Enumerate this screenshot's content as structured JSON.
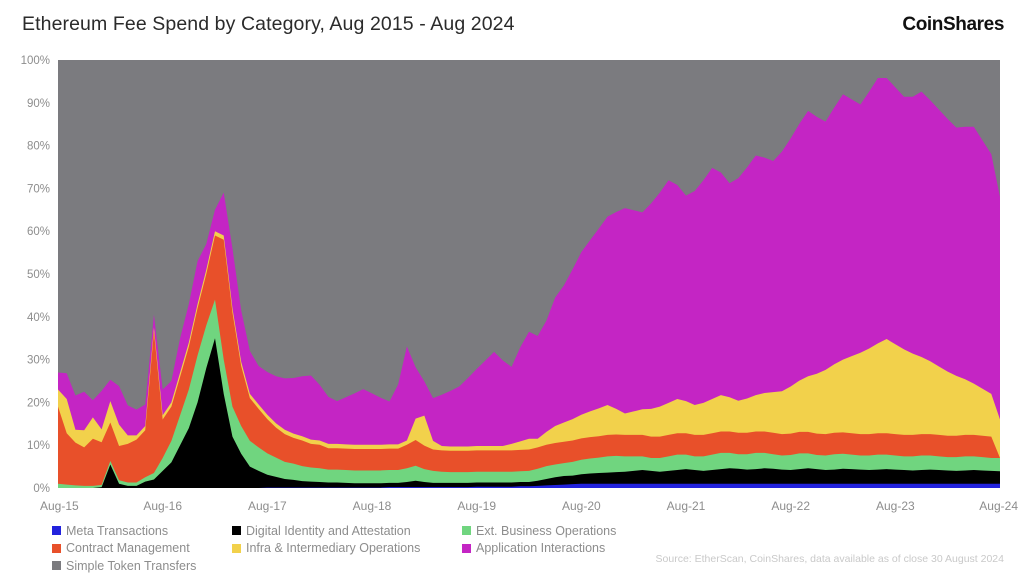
{
  "header": {
    "title": "Ethereum Fee Spend by Category, Aug 2015 - Aug 2024",
    "brand": "CoinShares"
  },
  "footer": {
    "source": "Source: EtherScan, CoinShares, data available as of close 30 August 2024"
  },
  "legend": {
    "rows": [
      [
        {
          "label": "Meta Transactions",
          "color": "#2222dd",
          "key": "meta_transactions"
        },
        {
          "label": "Digital Identity and Attestation",
          "color": "#000000",
          "key": "digital_identity"
        },
        {
          "label": "Ext. Business Operations",
          "color": "#70d57f",
          "key": "ext_business"
        }
      ],
      [
        {
          "label": "Contract Management",
          "color": "#e8502a",
          "key": "contract_management"
        },
        {
          "label": "Infra & Intermediary Operations",
          "color": "#f2d14b",
          "key": "infra_intermediary"
        },
        {
          "label": "Application Interactions",
          "color": "#c425c4",
          "key": "application_interactions"
        }
      ],
      [
        {
          "label": "Simple Token Transfers",
          "color": "#7b7b7f",
          "key": "simple_token_transfers"
        }
      ]
    ]
  },
  "chart_data": {
    "type": "area",
    "stacked": true,
    "normalized": true,
    "title": "Ethereum Fee Spend by Category, Aug 2015 - Aug 2024",
    "xlabel": "",
    "ylabel": "",
    "ylim": [
      0,
      100
    ],
    "yticks": [
      "0%",
      "10%",
      "20%",
      "30%",
      "40%",
      "50%",
      "60%",
      "70%",
      "80%",
      "90%",
      "100%"
    ],
    "ytick_values": [
      0,
      10,
      20,
      30,
      40,
      50,
      60,
      70,
      80,
      90,
      100
    ],
    "xticks": [
      "Aug-15",
      "Aug-16",
      "Aug-17",
      "Aug-18",
      "Aug-19",
      "Aug-20",
      "Aug-21",
      "Aug-22",
      "Aug-23",
      "Aug-24"
    ],
    "xtick_values": [
      0,
      12,
      24,
      36,
      48,
      60,
      72,
      84,
      96,
      108
    ],
    "x_unit": "months since Aug-2015",
    "x_count": 109,
    "grid": false,
    "legend_position": "bottom-left",
    "plot_background": "#7b7b7f",
    "series": [
      {
        "name": "Meta Transactions",
        "color": "#2222dd",
        "values": [
          0,
          0,
          0,
          0,
          0,
          0,
          0,
          0,
          0,
          0,
          0,
          0,
          0,
          0,
          0,
          0,
          0,
          0,
          0,
          0,
          0,
          0,
          0,
          0,
          0.1,
          0.1,
          0.1,
          0.1,
          0.1,
          0.1,
          0.1,
          0.1,
          0.1,
          0.1,
          0.1,
          0.1,
          0.1,
          0.1,
          0.2,
          0.2,
          0.2,
          0.2,
          0.2,
          0.2,
          0.2,
          0.2,
          0.2,
          0.2,
          0.3,
          0.3,
          0.3,
          0.3,
          0.3,
          0.4,
          0.4,
          0.5,
          0.6,
          0.7,
          0.8,
          0.9,
          1,
          1,
          1,
          1,
          1,
          1,
          1,
          1,
          1,
          1,
          1,
          1,
          1,
          1,
          1,
          1,
          1,
          1,
          1,
          1,
          1,
          1,
          1,
          1,
          1,
          1,
          1,
          1,
          1,
          1,
          1,
          1,
          1,
          1,
          1,
          1,
          1,
          1,
          1,
          1,
          1,
          1,
          1,
          1,
          1,
          1,
          1,
          1,
          1,
          1,
          1
        ]
      },
      {
        "name": "Digital Identity and Attestation",
        "color": "#000000",
        "values": [
          0,
          0,
          0,
          0,
          0,
          0.2,
          5.5,
          1,
          0.5,
          0.5,
          1.5,
          2,
          4,
          6,
          10,
          14,
          20,
          28,
          35,
          22,
          12,
          8,
          5,
          4,
          3,
          2.5,
          2,
          1.8,
          1.5,
          1.4,
          1.3,
          1.2,
          1.2,
          1.1,
          1,
          1,
          1,
          1,
          1,
          1,
          1.2,
          1.5,
          1.2,
          1,
          1,
          1,
          1,
          1,
          1,
          1,
          1,
          1,
          1,
          1,
          1,
          1.2,
          1.5,
          1.8,
          2,
          2,
          2.2,
          2.4,
          2.5,
          2.6,
          2.7,
          2.8,
          3,
          3.2,
          3,
          2.8,
          3,
          3.2,
          3.4,
          3.2,
          3,
          3.2,
          3.4,
          3.6,
          3.5,
          3.3,
          3.4,
          3.6,
          3.5,
          3.3,
          3.2,
          3.4,
          3.6,
          3.4,
          3.2,
          3.3,
          3.5,
          3.4,
          3.3,
          3.2,
          3.3,
          3.4,
          3.3,
          3.2,
          3.1,
          3.2,
          3.3,
          3.2,
          3.1,
          3,
          3.1,
          3.2,
          3.1,
          3,
          2.9,
          3
        ]
      },
      {
        "name": "Ext. Business Operations",
        "color": "#70d57f",
        "values": [
          1,
          0.8,
          0.6,
          0.5,
          0.5,
          0.5,
          0.8,
          0.8,
          0.8,
          0.8,
          1,
          1.5,
          3,
          5,
          7,
          9,
          11,
          10,
          9,
          8,
          7,
          6.5,
          6,
          5.5,
          5,
          4.5,
          4,
          3.8,
          3.5,
          3.3,
          3.2,
          3,
          3,
          3,
          3,
          3,
          3,
          3,
          3,
          3,
          3.2,
          3.5,
          3,
          2.8,
          2.6,
          2.5,
          2.5,
          2.5,
          2.5,
          2.5,
          2.5,
          2.5,
          2.5,
          2.5,
          2.6,
          2.8,
          3,
          3,
          3,
          3.2,
          3.4,
          3.5,
          3.6,
          3.8,
          3.8,
          3.6,
          3.4,
          3.2,
          3,
          3.2,
          3.4,
          3.6,
          3.4,
          3.2,
          3.4,
          3.6,
          3.8,
          3.6,
          3.4,
          3.6,
          3.8,
          3.6,
          3.4,
          3.3,
          3.5,
          3.7,
          3.5,
          3.3,
          3.4,
          3.6,
          3.5,
          3.4,
          3.3,
          3.4,
          3.5,
          3.4,
          3.3,
          3.2,
          3.3,
          3.4,
          3.3,
          3.2,
          3.1,
          3.2,
          3.3,
          3.2,
          3.1,
          3,
          3.1
        ]
      },
      {
        "name": "Contract Management",
        "color": "#e8502a",
        "values": [
          18,
          12,
          10,
          9,
          11,
          10,
          9,
          8,
          9,
          10,
          11,
          33,
          9,
          8,
          9,
          10,
          11,
          12,
          15,
          28,
          22,
          14,
          10,
          9,
          8,
          7,
          6.5,
          6,
          6,
          5.5,
          5.5,
          5,
          5,
          5,
          5,
          5,
          5,
          5,
          5,
          5,
          5.5,
          6,
          5.5,
          5,
          5,
          5,
          5,
          5,
          5,
          5,
          5,
          5,
          5,
          5,
          5,
          5,
          5,
          5,
          5,
          5,
          5,
          5,
          5,
          5,
          5,
          5,
          5,
          5,
          5,
          5,
          5,
          5,
          5,
          5,
          5,
          5,
          5,
          5,
          5,
          5,
          5,
          5,
          5,
          5,
          5,
          5,
          5,
          5,
          5,
          5,
          5,
          5,
          5,
          5,
          5,
          5,
          5,
          5,
          5,
          5,
          5,
          5,
          5,
          5,
          5,
          5,
          5,
          5
        ]
      },
      {
        "name": "Infra & Intermediary Operations",
        "color": "#f2d14b",
        "values": [
          4,
          8,
          3,
          4,
          5,
          3,
          5,
          5,
          2,
          1,
          1,
          1,
          1,
          1,
          1,
          1,
          1,
          1,
          1,
          1,
          1,
          1,
          1,
          1,
          1,
          1,
          1,
          1,
          1,
          1,
          1,
          1,
          1,
          1,
          1,
          1,
          1,
          1,
          1,
          1,
          1,
          5,
          7,
          2,
          1,
          1,
          1,
          1,
          1,
          1,
          1,
          1,
          1.5,
          2,
          2.5,
          2,
          3,
          4,
          4.5,
          5,
          5.5,
          6,
          6.5,
          7,
          6,
          5,
          5.5,
          6,
          6.5,
          7,
          7.5,
          8,
          7.5,
          7,
          7.5,
          8,
          8.5,
          8,
          7.5,
          8,
          8.5,
          9,
          9.5,
          10,
          11,
          12,
          13,
          14,
          15,
          16,
          17,
          18,
          19,
          20,
          21,
          22,
          21,
          20,
          19,
          18,
          17,
          16,
          15,
          14,
          13,
          12,
          11,
          10,
          9
        ]
      },
      {
        "name": "Application Interactions",
        "color": "#c425c4",
        "values": [
          4,
          6,
          8,
          9,
          4,
          9,
          5,
          9,
          7,
          6,
          5,
          3,
          6,
          5,
          8,
          9,
          10,
          6,
          5,
          10,
          14,
          12,
          10,
          9,
          10,
          11,
          12,
          13,
          14,
          15,
          13,
          11,
          10,
          11,
          12,
          13,
          12,
          11,
          10,
          14,
          22,
          12,
          8,
          10,
          12,
          13,
          14,
          16,
          18,
          20,
          22,
          20,
          18,
          22,
          25,
          24,
          26,
          30,
          32,
          35,
          38,
          40,
          42,
          44,
          46,
          48,
          47,
          46,
          48,
          50,
          52,
          50,
          48,
          50,
          52,
          54,
          52,
          50,
          52,
          54,
          56,
          55,
          54,
          56,
          58,
          60,
          62,
          60,
          58,
          60,
          62,
          60,
          58,
          60,
          62,
          61,
          60,
          59,
          60,
          62,
          61,
          60,
          59,
          58,
          59,
          60,
          58,
          56,
          52
        ]
      },
      {
        "name": "Simple Token Transfers",
        "color": "#7b7b7f",
        "values": [
          73,
          73.2,
          78.4,
          77.5,
          79.5,
          77.3,
          74.7,
          76.2,
          80.7,
          81.7,
          80.5,
          59.5,
          77,
          75,
          65,
          57,
          47,
          43,
          35,
          31,
          44,
          58.5,
          68,
          71.5,
          72.9,
          74.9,
          74.4,
          75.3,
          74.9,
          74.7,
          76.9,
          79.7,
          80.7,
          79.8,
          78.9,
          77.9,
          78.9,
          79.9,
          80.8,
          76.8,
          68.9,
          71.6,
          75.6,
          79,
          79.2,
          78.3,
          77.3,
          75.3,
          73.2,
          71.2,
          69.2,
          71.2,
          73.2,
          69.2,
          65.9,
          66.7,
          63.7,
          57.9,
          55.7,
          52.6,
          49.2,
          46.7,
          44.6,
          42.3,
          40.6,
          38.8,
          39.6,
          40.8,
          39,
          36.9,
          34.6,
          35.2,
          37.2,
          35.5,
          33.5,
          31.5,
          32.9,
          34.7,
          32.9,
          30.9,
          29.2,
          29.2,
          29.6,
          28.6,
          26.4,
          23.5,
          21.2,
          20,
          19.1,
          17.2,
          14.2,
          14,
          12.8,
          10.8,
          8.8,
          6.8,
          9.1,
          11.3,
          13.4,
          15.4,
          13.3,
          15.4,
          17.5,
          18.6,
          19.7,
          21.8,
          23.7,
          25.8,
          27.9
        ]
      }
    ]
  }
}
